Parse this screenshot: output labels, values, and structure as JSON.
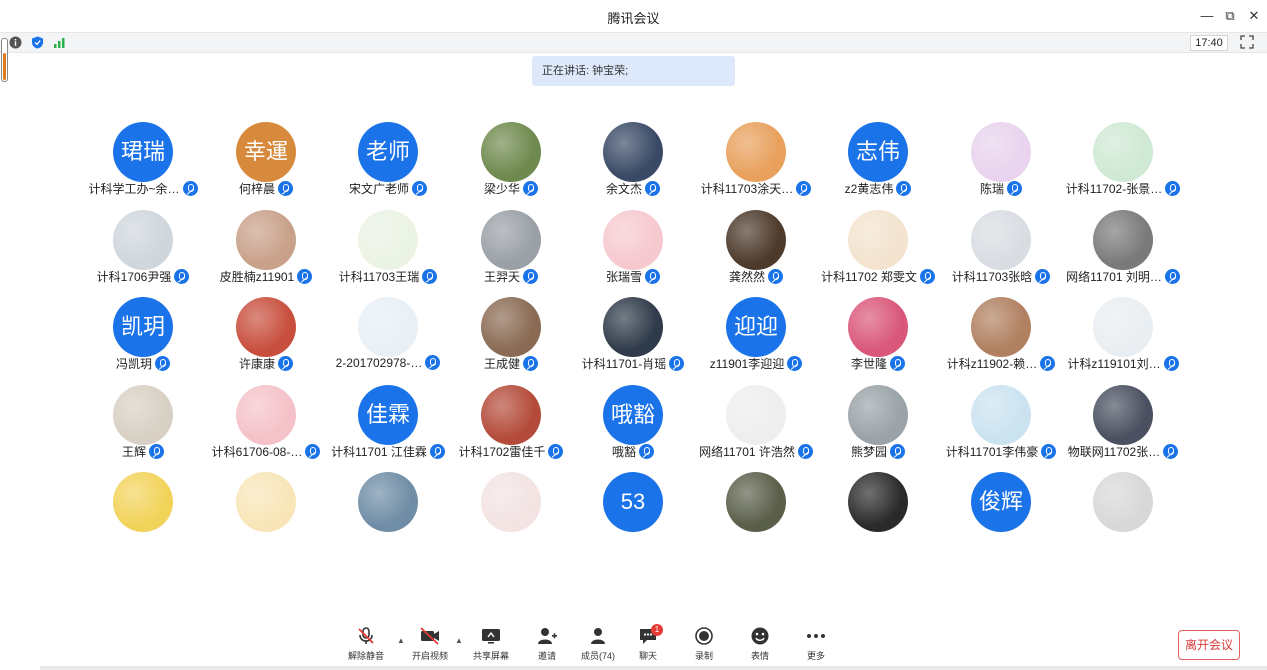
{
  "window": {
    "title": "腾讯会议",
    "min": "—",
    "restore": "⧉",
    "close": "✕"
  },
  "status": {
    "time": "17:40",
    "level": 0.65
  },
  "speaking": "正在讲话: 钟宝荣;",
  "participants": [
    {
      "name": "计科学工办~余…",
      "avatar_text": "珺瑞",
      "color": "#1a73e8"
    },
    {
      "name": "何梓晨",
      "avatar_text": "幸運",
      "color": "#d88a3c"
    },
    {
      "name": "宋文广老师",
      "avatar_text": "老师",
      "color": "#1a73e8"
    },
    {
      "name": "梁少华",
      "avatar_text": "",
      "color": "#6f8a4e"
    },
    {
      "name": "余文杰",
      "avatar_text": "",
      "color": "#3a4a66"
    },
    {
      "name": "计科11703涂天…",
      "avatar_text": "",
      "color": "#e8a05c"
    },
    {
      "name": "z2黄志伟",
      "avatar_text": "志伟",
      "color": "#1a73e8"
    },
    {
      "name": "陈瑞",
      "avatar_text": "",
      "color": "#e9d3ee"
    },
    {
      "name": "计科11702-张景…",
      "avatar_text": "",
      "color": "#cfe9d4"
    },
    {
      "name": "计科1706尹强",
      "avatar_text": "",
      "color": "#cfd6dc"
    },
    {
      "name": "皮胜楠z11901",
      "avatar_text": "",
      "color": "#c9a18a"
    },
    {
      "name": "计科11703王瑞",
      "avatar_text": "",
      "color": "#eaf3e4"
    },
    {
      "name": "王羿天",
      "avatar_text": "",
      "color": "#9aa0a6"
    },
    {
      "name": "张瑞雪",
      "avatar_text": "",
      "color": "#f6c9cf"
    },
    {
      "name": "龚然然",
      "avatar_text": "",
      "color": "#4d3a2b"
    },
    {
      "name": "计科11702 郑雯文",
      "avatar_text": "",
      "color": "#f3e3cf"
    },
    {
      "name": "计科11703张晗",
      "avatar_text": "",
      "color": "#d9dde2"
    },
    {
      "name": "网络11701 刘明…",
      "avatar_text": "",
      "color": "#7a7a7a"
    },
    {
      "name": "冯凯玥",
      "avatar_text": "凯玥",
      "color": "#1a73e8"
    },
    {
      "name": "许康康",
      "avatar_text": "",
      "color": "#c84f3e"
    },
    {
      "name": "2-201702978-…",
      "avatar_text": "",
      "color": "#e8f0f6"
    },
    {
      "name": "王成健",
      "avatar_text": "",
      "color": "#8a6a52"
    },
    {
      "name": "计科11701-肖瑶",
      "avatar_text": "",
      "color": "#2f3b4a"
    },
    {
      "name": "z11901李迎迎",
      "avatar_text": "迎迎",
      "color": "#1a73e8"
    },
    {
      "name": "李世隆",
      "avatar_text": "",
      "color": "#d9577a"
    },
    {
      "name": "计科z11902-赖…",
      "avatar_text": "",
      "color": "#b08060"
    },
    {
      "name": "计科z119101刘…",
      "avatar_text": "",
      "color": "#e9eef2"
    },
    {
      "name": "王辉",
      "avatar_text": "",
      "color": "#d8d0c4"
    },
    {
      "name": "计科61706-08-…",
      "avatar_text": "",
      "color": "#f4c2c8"
    },
    {
      "name": "计科11701 江佳霖",
      "avatar_text": "佳霖",
      "color": "#1a73e8"
    },
    {
      "name": "计科1702雷佳千",
      "avatar_text": "",
      "color": "#b44b3a"
    },
    {
      "name": "哦豁",
      "avatar_text": "哦豁",
      "color": "#1a73e8"
    },
    {
      "name": "网络11701 许浩然",
      "avatar_text": "",
      "color": "#eeeeee"
    },
    {
      "name": "熊梦园",
      "avatar_text": "",
      "color": "#9aa3a8"
    },
    {
      "name": "计科11701李伟豪",
      "avatar_text": "",
      "color": "#cbe3f0"
    },
    {
      "name": "物联网11702张…",
      "avatar_text": "",
      "color": "#4a5060"
    },
    {
      "name": "",
      "avatar_text": "",
      "color": "#f2d35a"
    },
    {
      "name": "",
      "avatar_text": "",
      "color": "#f8e6b8"
    },
    {
      "name": "",
      "avatar_text": "",
      "color": "#6f8da6"
    },
    {
      "name": "",
      "avatar_text": "",
      "color": "#f3e3e3"
    },
    {
      "name": "",
      "avatar_text": "53",
      "color": "#1a73e8"
    },
    {
      "name": "",
      "avatar_text": "",
      "color": "#5a5f4a"
    },
    {
      "name": "",
      "avatar_text": "",
      "color": "#2a2a2a"
    },
    {
      "name": "",
      "avatar_text": "俊辉",
      "color": "#1a73e8"
    },
    {
      "name": "",
      "avatar_text": "",
      "color": "#d8d8d8"
    }
  ],
  "toolbar": {
    "unmute": "解除静音",
    "start_video": "开启视频",
    "share": "共享屏幕",
    "invite": "邀请",
    "members": "成员(74)",
    "chat": "聊天",
    "chat_badge": "1",
    "record": "录制",
    "emoji": "表情",
    "more": "更多",
    "caret": "▲"
  },
  "leave": "离开会议",
  "colors": {
    "accent": "#1a73e8",
    "danger": "#d83b3b"
  }
}
